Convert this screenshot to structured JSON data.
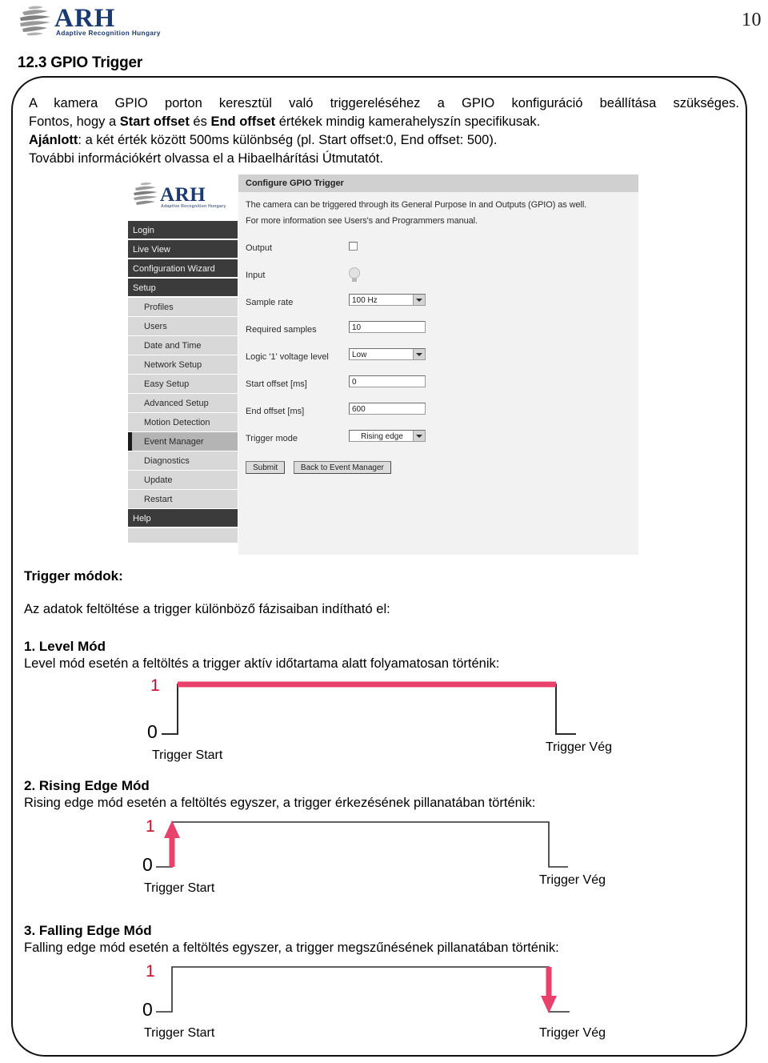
{
  "page": {
    "number": "10",
    "brand": {
      "name": "ARH",
      "tagline": "Adaptive Recognition Hungary"
    },
    "section_heading": "12.3 GPIO Trigger"
  },
  "intro": {
    "line1": "A kamera GPIO porton keresztül való triggereléséhez a GPIO konfiguráció beállítása szükséges.",
    "line2_pre": "Fontos, hogy a ",
    "line2_b1": "Start offset",
    "line2_mid": " és ",
    "line2_b2": "End offset",
    "line2_post": " értékek mindig kamerahelyszín specifikusak.",
    "line3_b": "Ajánlott",
    "line3_post": ": a két érték között 500ms különbség (pl. Start offset:0, End offset: 500).",
    "line4": "További információkért olvassa el a Hibaelhárítási Útmutatót."
  },
  "app": {
    "panel_title": "Configure GPIO Trigger",
    "description_line1": "The camera can be triggered through its General Purpose In and Outputs (GPIO) as well.",
    "description_line2": "For more information see Users's and Programmers manual.",
    "nav": [
      {
        "label": "Login",
        "style": "dark",
        "selected": false
      },
      {
        "label": "Live View",
        "style": "dark",
        "selected": false
      },
      {
        "label": "Configuration Wizard",
        "style": "dark",
        "selected": false
      },
      {
        "label": "Setup",
        "style": "dark",
        "selected": false
      },
      {
        "label": "Profiles",
        "style": "light",
        "selected": false
      },
      {
        "label": "Users",
        "style": "light",
        "selected": false
      },
      {
        "label": "Date and Time",
        "style": "light",
        "selected": false
      },
      {
        "label": "Network Setup",
        "style": "light",
        "selected": false
      },
      {
        "label": "Easy Setup",
        "style": "light",
        "selected": false
      },
      {
        "label": "Advanced Setup",
        "style": "light",
        "selected": false
      },
      {
        "label": "Motion Detection",
        "style": "light",
        "selected": false
      },
      {
        "label": "Event Manager",
        "style": "light",
        "selected": true
      },
      {
        "label": "Diagnostics",
        "style": "light",
        "selected": false
      },
      {
        "label": "Update",
        "style": "light",
        "selected": false
      },
      {
        "label": "Restart",
        "style": "light",
        "selected": false
      },
      {
        "label": "Help",
        "style": "dark",
        "selected": false
      }
    ],
    "fields": {
      "output_label": "Output",
      "output_checked": false,
      "input_label": "Input",
      "input_icon": "lightbulb-icon",
      "sample_rate_label": "Sample rate",
      "sample_rate_value": "100 Hz",
      "required_samples_label": "Required samples",
      "required_samples_value": "10",
      "logic_level_label": "Logic '1' voltage level",
      "logic_level_value": "Low",
      "start_offset_label": "Start offset [ms]",
      "start_offset_value": "0",
      "end_offset_label": "End offset [ms]",
      "end_offset_value": "600",
      "trigger_mode_label": "Trigger mode",
      "trigger_mode_value": "Rising edge"
    },
    "buttons": {
      "submit": "Submit",
      "back": "Back to Event Manager"
    }
  },
  "modes": {
    "title": "Trigger módok:",
    "intro": "Az adatok feltöltése a trigger különböző fázisaiban indítható el:",
    "accent_color": "#E8416B",
    "items": [
      {
        "title": "1. Level Mód",
        "desc": "Level mód esetén a feltöltés a trigger aktív időtartama alatt folyamatosan történik:",
        "high_label": "1",
        "low_label": "0",
        "start_label": "Trigger Start",
        "end_label": "Trigger Vég",
        "highlight": "high-level"
      },
      {
        "title": "2. Rising Edge Mód",
        "desc": "Rising edge mód esetén a feltöltés egyszer, a trigger érkezésének pillanatában történik:",
        "high_label": "1",
        "low_label": "0",
        "start_label": "Trigger Start",
        "end_label": "Trigger Vég",
        "highlight": "rising-arrow"
      },
      {
        "title": "3. Falling Edge Mód",
        "desc": "Falling edge mód esetén a feltöltés egyszer, a trigger megszűnésének pillanatában történik:",
        "high_label": "1",
        "low_label": "0",
        "start_label": "Trigger Start",
        "end_label": "Trigger Vég",
        "highlight": "falling-arrow"
      }
    ]
  }
}
